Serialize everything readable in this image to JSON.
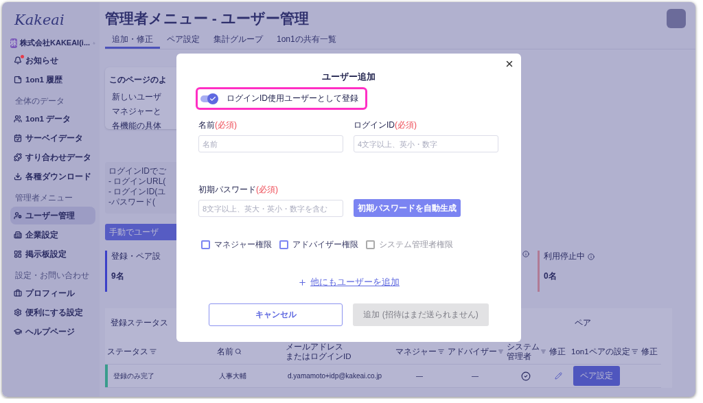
{
  "sidebar": {
    "logo": "Kakeai",
    "company": {
      "badge": "株",
      "name": "株式会社KAKEAI(i..."
    },
    "groups": [
      {
        "items": [
          {
            "label": "お知らせ",
            "selected": false,
            "notification": true
          },
          {
            "label": "1on1 履歴",
            "selected": false,
            "notification": false
          }
        ]
      },
      {
        "heading": "全体のデータ",
        "items": [
          {
            "label": "1on1 データ",
            "selected": false,
            "notification": false
          },
          {
            "label": "サーベイデータ",
            "selected": false,
            "notification": false
          },
          {
            "label": "すり合わせデータ",
            "selected": false,
            "notification": false
          },
          {
            "label": "各種ダウンロード",
            "selected": false,
            "notification": false
          }
        ]
      },
      {
        "heading": "管理者メニュー",
        "items": [
          {
            "label": "ユーザー管理",
            "selected": true,
            "notification": false
          },
          {
            "label": "企業設定",
            "selected": false,
            "notification": false
          },
          {
            "label": "掲示板設定",
            "selected": false,
            "notification": false
          }
        ]
      },
      {
        "heading": "設定・お問い合わせ",
        "items": [
          {
            "label": "プロフィール",
            "selected": false,
            "notification": false
          },
          {
            "label": "便利にする設定",
            "selected": false,
            "notification": false
          },
          {
            "label": "ヘルプページ",
            "selected": false,
            "notification": false
          }
        ]
      }
    ]
  },
  "header": {
    "title": "管理者メニュー - ユーザー管理",
    "tabs": [
      {
        "label": "追加・修正",
        "selected": true
      },
      {
        "label": "ペア設定",
        "selected": false
      },
      {
        "label": "集計グループ",
        "selected": false
      },
      {
        "label": "1on1の共有一覧",
        "selected": false
      }
    ]
  },
  "faq": {
    "title": "このページのよ",
    "lines": [
      "新しいユーザ",
      "マネジャーと",
      "各機能の具体"
    ]
  },
  "info": [
    "ログインIDでご",
    "- ログインURL(",
    "- ログインID(ユ",
    "-パスワード("
  ],
  "add_button": "手動でユーザ",
  "stats": [
    {
      "label": "登録・ペア設",
      "count": "9名",
      "color": "#3b40c8",
      "info": false
    },
    {
      "label": "利用停止中",
      "count": "0名",
      "color": "#b07a95",
      "info": true
    }
  ],
  "table": {
    "groups": [
      {
        "label": "登録ステータス",
        "kind": "status"
      },
      {
        "label": "ペア",
        "kind": "pair"
      }
    ],
    "columns": [
      {
        "lines": [
          "ステータス"
        ],
        "kind": "filter"
      },
      {
        "lines": [
          "名前"
        ],
        "kind": "search"
      },
      {
        "lines": [
          "メールアドレス",
          "またはログインID"
        ],
        "kind": "plain"
      },
      {
        "lines": [
          "マネジャー"
        ],
        "kind": "filter"
      },
      {
        "lines": [
          "アドバイザー"
        ],
        "kind": "filter"
      },
      {
        "lines": [
          "システム",
          "管理者"
        ],
        "kind": "filter"
      },
      {
        "lines": [
          "修正"
        ],
        "kind": "plain"
      },
      {
        "lines": [
          "1on1ペアの設定"
        ],
        "kind": "filter"
      },
      {
        "lines": [
          "修正"
        ],
        "kind": "plain"
      }
    ],
    "rows": [
      {
        "status": "登録のみ完了",
        "color": "#3a9c8c",
        "name": "人事大輔",
        "email": "d.yamamoto+idp@kakeai.co.jp",
        "manager": "—",
        "advisor": "—",
        "sysadmin": true,
        "pair_button": "ペア設定"
      }
    ]
  },
  "modal": {
    "title": "ユーザー追加",
    "login_toggle": {
      "label": "ログインID使用ユーザーとして登録",
      "on": true,
      "highlighted": true
    },
    "fields": [
      {
        "label": "名前",
        "required": "(必須)",
        "placeholder": "名前"
      },
      {
        "label": "ログインID",
        "required": "(必須)",
        "placeholder": "4文字以上、英小・数字"
      },
      {
        "label": "初期パスワード",
        "required": "(必須)",
        "placeholder": "8文字以上、英大・英小・数字を含む"
      }
    ],
    "generate_button": "初期パスワードを自動生成",
    "roles": [
      {
        "label": "マネジャー権限",
        "checked": false,
        "disabled": false
      },
      {
        "label": "アドバイザー権限",
        "checked": false,
        "disabled": false
      },
      {
        "label": "システム管理者権限",
        "checked": false,
        "disabled": true
      }
    ],
    "add_more": "他にもユーザーを追加",
    "cancel": "キャンセル",
    "submit": {
      "label": "追加",
      "note": "(招待はまだ送られません)",
      "disabled": true
    }
  }
}
